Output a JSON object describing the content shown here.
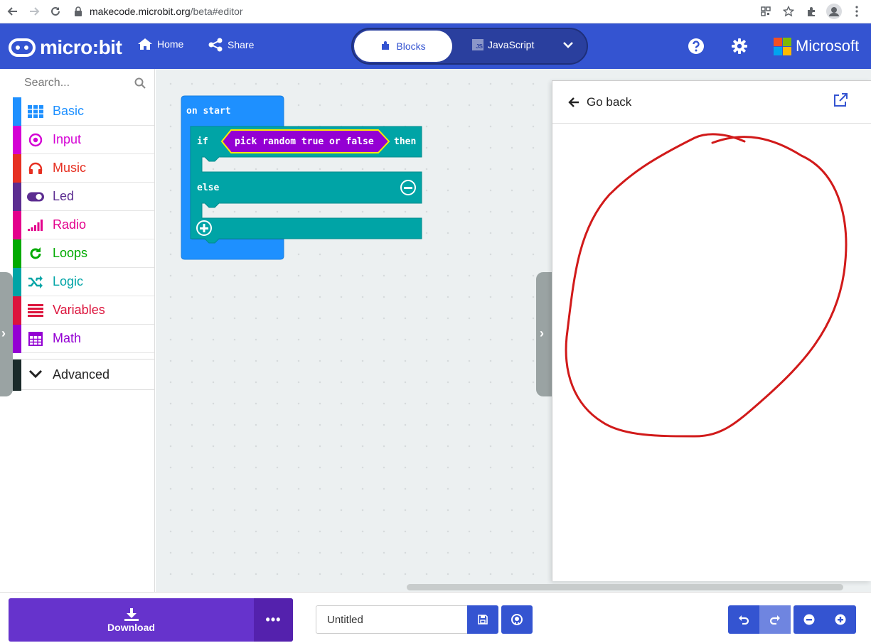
{
  "browser": {
    "url_host": "makecode.microbit.org",
    "url_path": "/beta#editor"
  },
  "header": {
    "logo_text": "micro:bit",
    "home_label": "Home",
    "share_label": "Share",
    "blocks_label": "Blocks",
    "javascript_label": "JavaScript",
    "microsoft_label": "Microsoft",
    "accent_color": "#3454d1"
  },
  "toolbox": {
    "search_placeholder": "Search...",
    "categories": [
      {
        "label": "Basic",
        "color": "#1e90ff",
        "icon": "grid-icon"
      },
      {
        "label": "Input",
        "color": "#d400d4",
        "icon": "target-icon"
      },
      {
        "label": "Music",
        "color": "#e63022",
        "icon": "headphones-icon"
      },
      {
        "label": "Led",
        "color": "#5c2d91",
        "icon": "toggle-icon"
      },
      {
        "label": "Radio",
        "color": "#e3008c",
        "icon": "signal-icon"
      },
      {
        "label": "Loops",
        "color": "#00aa00",
        "icon": "refresh-icon"
      },
      {
        "label": "Logic",
        "color": "#00a4a6",
        "icon": "shuffle-icon"
      },
      {
        "label": "Variables",
        "color": "#dc143c",
        "icon": "list-icon"
      },
      {
        "label": "Math",
        "color": "#9400d3",
        "icon": "calculator-icon"
      }
    ],
    "advanced_label": "Advanced"
  },
  "blocks": {
    "on_start": "on start",
    "if_label": "if",
    "condition": "pick random true or false",
    "then_label": "then",
    "else_label": "else"
  },
  "panel": {
    "go_back_label": "Go back"
  },
  "bottom": {
    "download_label": "Download",
    "more_label": "•••",
    "project_name": "Untitled"
  }
}
